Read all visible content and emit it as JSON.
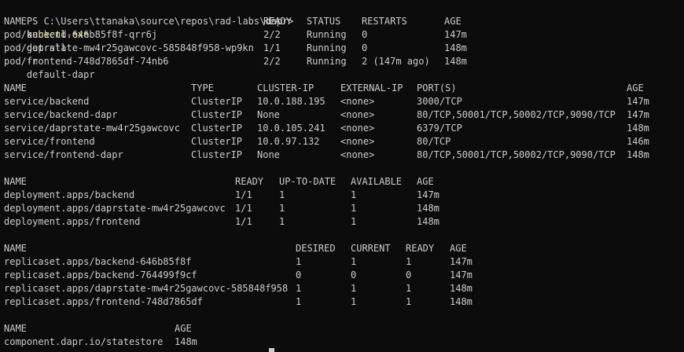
{
  "prompt": {
    "path": "PS C:\\Users\\ttanaka\\source\\repos\\rad-labs\\dapr>",
    "command": "kubectl.exe",
    "args": "get all",
    "flag": "-n",
    "namespace": "default-dapr"
  },
  "pods": {
    "headers": [
      "NAME",
      "READY",
      "STATUS",
      "RESTARTS",
      "AGE"
    ],
    "rows": [
      [
        "pod/backend-646b85f8f-qrr6j",
        "2/2",
        "Running",
        "0",
        "147m"
      ],
      [
        "pod/daprstate-mw4r25gawcovc-585848f958-wp9kn",
        "1/1",
        "Running",
        "0",
        "148m"
      ],
      [
        "pod/frontend-748d7865df-74nb6",
        "2/2",
        "Running",
        "2 (147m ago)",
        "148m"
      ]
    ]
  },
  "services": {
    "headers": [
      "NAME",
      "TYPE",
      "CLUSTER-IP",
      "EXTERNAL-IP",
      "PORT(S)",
      "AGE"
    ],
    "rows": [
      [
        "service/backend",
        "ClusterIP",
        "10.0.188.195",
        "<none>",
        "3000/TCP",
        "147m"
      ],
      [
        "service/backend-dapr",
        "ClusterIP",
        "None",
        "<none>",
        "80/TCP,50001/TCP,50002/TCP,9090/TCP",
        "147m"
      ],
      [
        "service/daprstate-mw4r25gawcovc",
        "ClusterIP",
        "10.0.105.241",
        "<none>",
        "6379/TCP",
        "148m"
      ],
      [
        "service/frontend",
        "ClusterIP",
        "10.0.97.132",
        "<none>",
        "80/TCP",
        "146m"
      ],
      [
        "service/frontend-dapr",
        "ClusterIP",
        "None",
        "<none>",
        "80/TCP,50001/TCP,50002/TCP,9090/TCP",
        "148m"
      ]
    ]
  },
  "deployments": {
    "headers": [
      "NAME",
      "READY",
      "UP-TO-DATE",
      "AVAILABLE",
      "AGE"
    ],
    "rows": [
      [
        "deployment.apps/backend",
        "1/1",
        "1",
        "1",
        "147m"
      ],
      [
        "deployment.apps/daprstate-mw4r25gawcovc",
        "1/1",
        "1",
        "1",
        "148m"
      ],
      [
        "deployment.apps/frontend",
        "1/1",
        "1",
        "1",
        "148m"
      ]
    ]
  },
  "replicasets": {
    "headers": [
      "NAME",
      "DESIRED",
      "CURRENT",
      "READY",
      "AGE"
    ],
    "rows": [
      [
        "replicaset.apps/backend-646b85f8f",
        "1",
        "1",
        "1",
        "147m"
      ],
      [
        "replicaset.apps/backend-764499f9cf",
        "0",
        "0",
        "0",
        "147m"
      ],
      [
        "replicaset.apps/daprstate-mw4r25gawcovc-585848f958",
        "1",
        "1",
        "1",
        "148m"
      ],
      [
        "replicaset.apps/frontend-748d7865df",
        "1",
        "1",
        "1",
        "148m"
      ]
    ]
  },
  "components": {
    "headers": [
      "NAME",
      "AGE"
    ],
    "rows": [
      [
        "component.dapr.io/statestore",
        "148m"
      ]
    ]
  },
  "colors": {
    "background": "#0c0c0c",
    "text": "#cccccc",
    "command": "#f9f1a5",
    "flag": "#9a9a9a"
  }
}
